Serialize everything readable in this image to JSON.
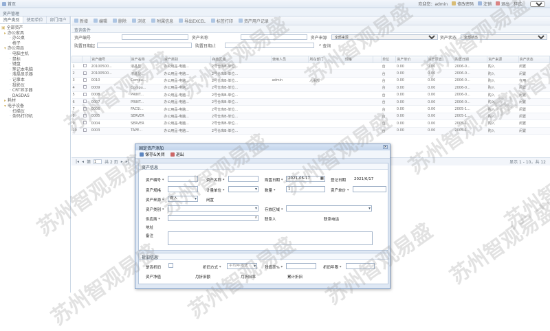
{
  "topbar": {
    "home": "首页",
    "welcome": "欢迎您：admin",
    "change_pwd": "修改密码",
    "logout": "注销",
    "exit": "退出",
    "style_label": "样式：",
    "style_value": "蓝色"
  },
  "subheader": {
    "title": "资产管理"
  },
  "sidebar": {
    "tabs": [
      "资产类别",
      "使用单位",
      "部门用户"
    ],
    "tree": [
      {
        "label": "全部资产",
        "indent": 0,
        "prefix": "▣"
      },
      {
        "label": "办公家具",
        "indent": 1,
        "prefix": "▸"
      },
      {
        "label": "办公桌",
        "indent": 3,
        "prefix": "·"
      },
      {
        "label": "椅子",
        "indent": 3,
        "prefix": "·"
      },
      {
        "label": "办公用品",
        "indent": 1,
        "prefix": "▾"
      },
      {
        "label": "电脑主机",
        "indent": 3,
        "prefix": "·"
      },
      {
        "label": "鼠标",
        "indent": 3,
        "prefix": "·"
      },
      {
        "label": "键盘",
        "indent": 3,
        "prefix": "·"
      },
      {
        "label": "笔记本电脑",
        "indent": 3,
        "prefix": "·"
      },
      {
        "label": "液晶显示器",
        "indent": 3,
        "prefix": "·"
      },
      {
        "label": "记事本",
        "indent": 3,
        "prefix": "·"
      },
      {
        "label": "投影仪",
        "indent": 3,
        "prefix": "·"
      },
      {
        "label": "CRT显示器",
        "indent": 3,
        "prefix": "·"
      },
      {
        "label": "DASDAS",
        "indent": 3,
        "prefix": "·"
      },
      {
        "label": "耗材",
        "indent": 1,
        "prefix": "▸"
      },
      {
        "label": "电子设备",
        "indent": 1,
        "prefix": "▾"
      },
      {
        "label": "扫描仪",
        "indent": 3,
        "prefix": "·"
      },
      {
        "label": "条码打印机",
        "indent": 3,
        "prefix": "·"
      }
    ]
  },
  "toolbar": {
    "add": "新增",
    "edit": "编辑",
    "delete": "删除",
    "view": "浏览",
    "attachment": "附属信息",
    "export": "导出EXCEL",
    "label_print": "标签打印",
    "asset_user_log": "资产用户记录"
  },
  "query": {
    "title": "查询条件",
    "asset_no": "资产编号",
    "asset_name": "资产名称",
    "asset_source": "资产来源",
    "source_value": "全部来源",
    "asset_status": "资产状态",
    "status_value": "全部状态",
    "purchase_start": "购置日期起",
    "purchase_end": "购置日期止",
    "search": "查询"
  },
  "grid": {
    "headers": [
      "",
      "",
      "资产编号",
      "资产名称",
      "资产类别",
      "存放区域",
      "使用人员",
      "所在部门",
      "规格",
      "",
      "单位",
      "资产单价",
      "资产原值",
      "购置日期",
      "资产来源",
      "资产状态"
    ],
    "rows": [
      [
        "1",
        "20100500...",
        "液晶显...",
        "办公用品-电脑...",
        "2号仓库B-单位...",
        "",
        "",
        "",
        "",
        "台",
        "0.00",
        "0.00",
        "2006-0...",
        "购入",
        "闲置"
      ],
      [
        "2",
        "20100500...",
        "液晶显...",
        "办公用品-电脑...",
        "2号仓库B-单位...",
        "",
        "",
        "",
        "",
        "台",
        "0.00",
        "0.00",
        "2006-0...",
        "购入",
        "闲置"
      ],
      [
        "3",
        "0010",
        "Compu...",
        "办公用品-电脑...",
        "2号仓库B-单位...",
        "admin",
        "人事部",
        "",
        "",
        "台",
        "0.00",
        "0.00",
        "2006-0...",
        "购入",
        "在用"
      ],
      [
        "4",
        "0009",
        "Compu...",
        "办公用品-电脑...",
        "2号仓库B-单位...",
        "",
        "",
        "",
        "",
        "台",
        "0.00",
        "0.00",
        "2006-0...",
        "购入",
        "闲置"
      ],
      [
        "5",
        "0008",
        "PRINT...",
        "办公用品-电脑...",
        "2号仓库B-单位...",
        "",
        "",
        "",
        "",
        "台",
        "0.00",
        "0.00",
        "2006-0...",
        "购入",
        "闲置"
      ],
      [
        "6",
        "0007",
        "PRINT...",
        "办公用品-电脑...",
        "2号仓库B-单位...",
        "",
        "",
        "",
        "",
        "台",
        "0.00",
        "0.00",
        "2006-0...",
        "购入",
        "闲置"
      ],
      [
        "7",
        "0006",
        "FACSI...",
        "办公用品-电脑...",
        "2号仓库B-单位...",
        "",
        "",
        "",
        "",
        "台",
        "0.00",
        "0.00",
        "2005-1...",
        "购入",
        "闲置"
      ],
      [
        "8",
        "0005",
        "SERVER",
        "办公用品-电脑...",
        "2号仓库B-单位...",
        "",
        "",
        "",
        "",
        "台",
        "0.00",
        "0.00",
        "2005-1...",
        "购入",
        "闲置"
      ],
      [
        "9",
        "0004",
        "SERVER",
        "办公用品-电脑...",
        "2号仓库B-单位...",
        "",
        "",
        "",
        "",
        "台",
        "0.00",
        "0.00",
        "2005-1...",
        "购入",
        "闲置"
      ],
      [
        "10",
        "0003",
        "TAPE...",
        "办公用品-电脑...",
        "2号仓库B-单位...",
        "",
        "",
        "",
        "",
        "台",
        "0.00",
        "0.00",
        "2005-1...",
        "购入",
        "闲置"
      ]
    ]
  },
  "pager": {
    "page_prefix": "第",
    "page_value": "1",
    "page_suffix": "共 2 页",
    "info": "显示 1 - 10，共 12"
  },
  "dialog": {
    "title": "固定资产添加",
    "save_close": "保存&关闭",
    "exit": "退出",
    "asset_info": "资产信息",
    "asset_no": "资产编号",
    "asset_name": "资产名称",
    "purchase_date": "购置日期",
    "purchase_date_value": "2021-06-17",
    "register_date": "登记日期",
    "register_date_value": "2021/6/17",
    "spec": "资产规格",
    "unit": "计量单位",
    "quantity": "数量",
    "quantity_value": "1",
    "unit_price": "资产单价",
    "source": "资产来源",
    "source_value": "购入",
    "status": "闲置",
    "category": "资产类别",
    "storage": "存放区域",
    "supplier": "供应商",
    "contact": "联系人",
    "contact_phone": "联系电话",
    "address": "地址",
    "remark": "备注",
    "depr_info": "折旧信息",
    "is_depr": "是否折旧",
    "depr_method": "折旧方式",
    "depr_method_value": "平均年限法",
    "salvage_rate": "残值率%",
    "depr_years": "折旧年限",
    "net_value": "资产净值",
    "monthly_amount": "月折旧额",
    "monthly_rate": "月折旧率",
    "accum": "累计折旧"
  },
  "watermark": "苏州智观易盛",
  "colors": {
    "accent": "#d6e3f3",
    "border": "#7f9cc4"
  }
}
